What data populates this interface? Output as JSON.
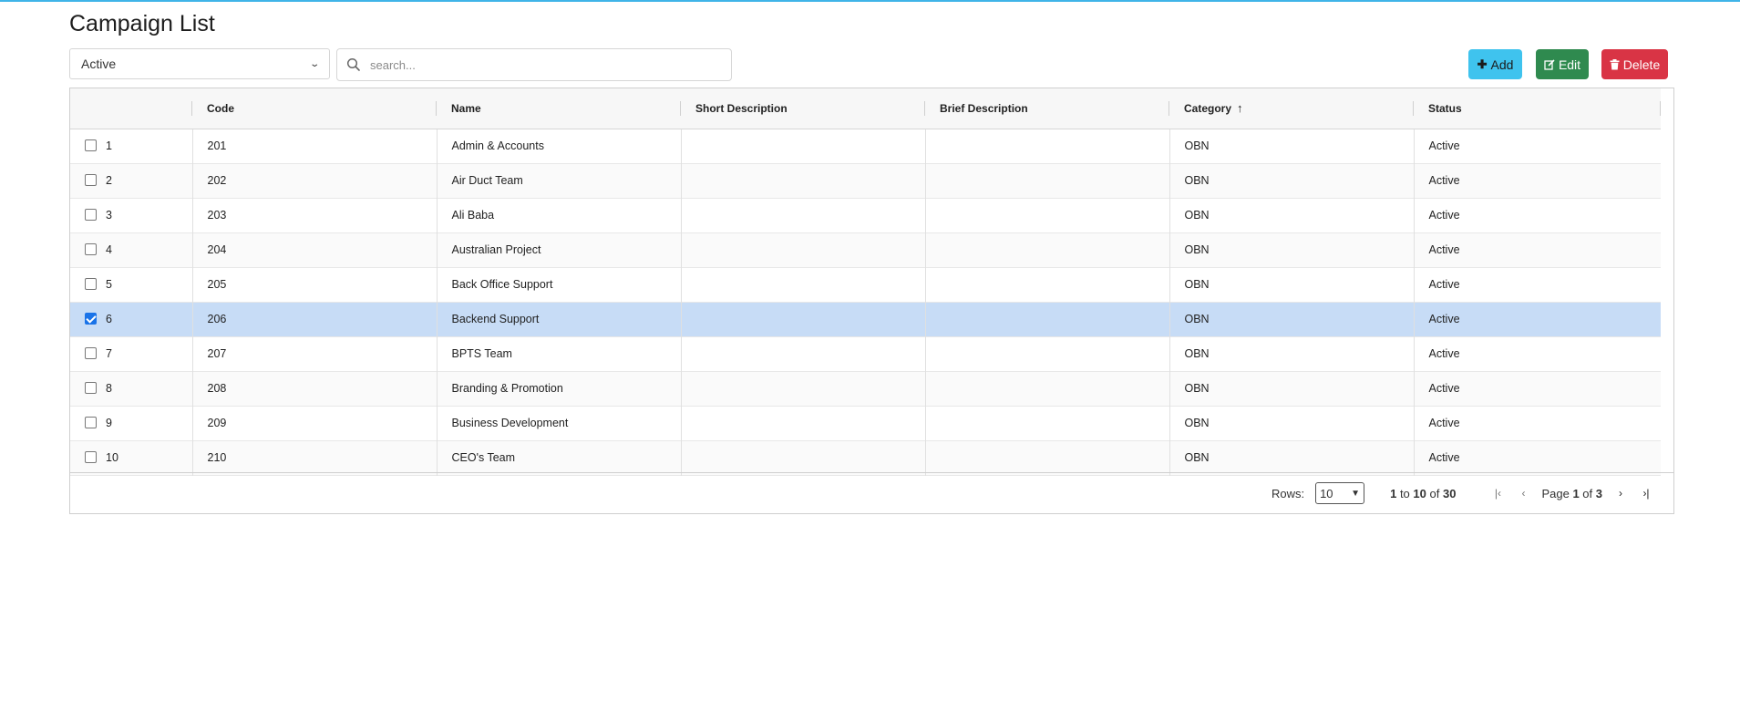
{
  "page": {
    "title": "Campaign List"
  },
  "filters": {
    "status_value": "Active",
    "search_placeholder": "search..."
  },
  "toolbar": {
    "add_label": "Add",
    "edit_label": "Edit",
    "delete_label": "Delete"
  },
  "table": {
    "columns": [
      "",
      "Code",
      "Name",
      "Short Description",
      "Brief Description",
      "Category",
      "Status"
    ],
    "sorted_column": "Category",
    "sort_direction": "ascending",
    "rows": [
      {
        "num": "1",
        "code": "201",
        "name": "Admin & Accounts",
        "short_desc": "",
        "brief_desc": "",
        "category": "OBN",
        "status": "Active",
        "checked": false
      },
      {
        "num": "2",
        "code": "202",
        "name": "Air Duct Team",
        "short_desc": "",
        "brief_desc": "",
        "category": "OBN",
        "status": "Active",
        "checked": false
      },
      {
        "num": "3",
        "code": "203",
        "name": "Ali Baba",
        "short_desc": "",
        "brief_desc": "",
        "category": "OBN",
        "status": "Active",
        "checked": false
      },
      {
        "num": "4",
        "code": "204",
        "name": "Australian Project",
        "short_desc": "",
        "brief_desc": "",
        "category": "OBN",
        "status": "Active",
        "checked": false
      },
      {
        "num": "5",
        "code": "205",
        "name": "Back Office Support",
        "short_desc": "",
        "brief_desc": "",
        "category": "OBN",
        "status": "Active",
        "checked": false
      },
      {
        "num": "6",
        "code": "206",
        "name": "Backend Support",
        "short_desc": "",
        "brief_desc": "",
        "category": "OBN",
        "status": "Active",
        "checked": true
      },
      {
        "num": "7",
        "code": "207",
        "name": "BPTS Team",
        "short_desc": "",
        "brief_desc": "",
        "category": "OBN",
        "status": "Active",
        "checked": false
      },
      {
        "num": "8",
        "code": "208",
        "name": "Branding & Promotion",
        "short_desc": "",
        "brief_desc": "",
        "category": "OBN",
        "status": "Active",
        "checked": false
      },
      {
        "num": "9",
        "code": "209",
        "name": "Business Development",
        "short_desc": "",
        "brief_desc": "",
        "category": "OBN",
        "status": "Active",
        "checked": false
      },
      {
        "num": "10",
        "code": "210",
        "name": "CEO's Team",
        "short_desc": "",
        "brief_desc": "",
        "category": "OBN",
        "status": "Active",
        "checked": false
      }
    ]
  },
  "paginator": {
    "rows_label": "Rows:",
    "rows_value": "10",
    "range_from": "1",
    "range_to": "10",
    "range_total": "30",
    "range_to_word": "to",
    "range_of_word": "of",
    "page_word": "Page",
    "page_current": "1",
    "page_of_word": "of",
    "page_total": "3"
  },
  "colors": {
    "accent_top_border": "#3fb4e8",
    "add_button": "#3fc3ee",
    "edit_button": "#2f8a4f",
    "delete_button": "#d93445",
    "selected_row": "#c7dcf6"
  }
}
